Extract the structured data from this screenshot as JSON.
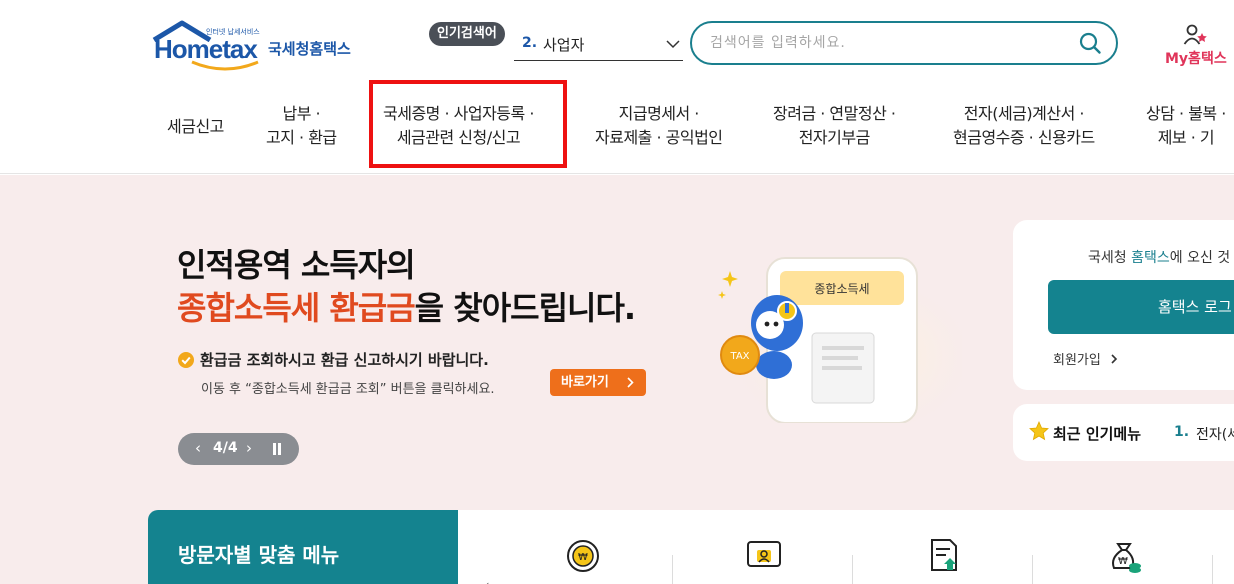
{
  "header": {
    "logo_word": "Hometax",
    "logo_tagline": "인터넷 납세서비스",
    "logo_kor": "국세청홈택스",
    "popular_badge": "인기검색어",
    "popular_rank": "2.",
    "popular_term": "사업자",
    "search_placeholder": "검색어를 입력하세요.",
    "my_label": "My홈택스"
  },
  "nav": {
    "items": [
      {
        "line1": "세금신고",
        "line2": ""
      },
      {
        "line1": "납부 ·",
        "line2": "고지 · 환급"
      },
      {
        "line1": "국세증명 · 사업자등록 ·",
        "line2": "세금관련 신청/신고"
      },
      {
        "line1": "지급명세서 ·",
        "line2": "자료제출 · 공익법인"
      },
      {
        "line1": "장려금 · 연말정산 ·",
        "line2": "전자기부금"
      },
      {
        "line1": "전자(세금)계산서 ·",
        "line2": "현금영수증 · 신용카드"
      },
      {
        "line1": "상담 · 불복 ·",
        "line2": "제보 · 기"
      }
    ]
  },
  "hero": {
    "title_line1": "인적용역 소득자의",
    "title_highlight": "종합소득세 환급금",
    "title_rest": "을 찾아드립니다.",
    "desc": "환급금 조회하시고 환급 신고하시기 바랍니다.",
    "sub": "이동 후 “종합소득세 환급금 조회” 버튼을 클릭하세요.",
    "button": "바로가기",
    "pager_count": "4/4",
    "illust_phone_label": "종합소득세",
    "illust_coin_label": "TAX"
  },
  "login": {
    "welcome_prefix": "국세청 ",
    "welcome_brand": "홈택스",
    "welcome_suffix": "에 오신 것",
    "login_button": "홈택스 로그",
    "signup": "회원가입"
  },
  "recent": {
    "title": "최근 인기메뉴",
    "rank": "1.",
    "item": "전자(세"
  },
  "visitor": {
    "title": "방문자별 맞춤 메뉴"
  },
  "colors": {
    "brand_blue": "#1c57a8",
    "teal": "#14838f",
    "hero_bg": "#f8ecec",
    "accent_orange": "#ee6f1b",
    "highlight_red": "#e04a1f",
    "nav_highlight_box": "#ee1111"
  },
  "icons": [
    "search-icon",
    "chevron-down-icon",
    "my-person-icon",
    "check-circle-icon",
    "chevron-right-icon",
    "pause-icon",
    "star-icon",
    "won-coin-icon",
    "monitor-person-icon",
    "document-upload-icon",
    "money-bag-icon"
  ]
}
